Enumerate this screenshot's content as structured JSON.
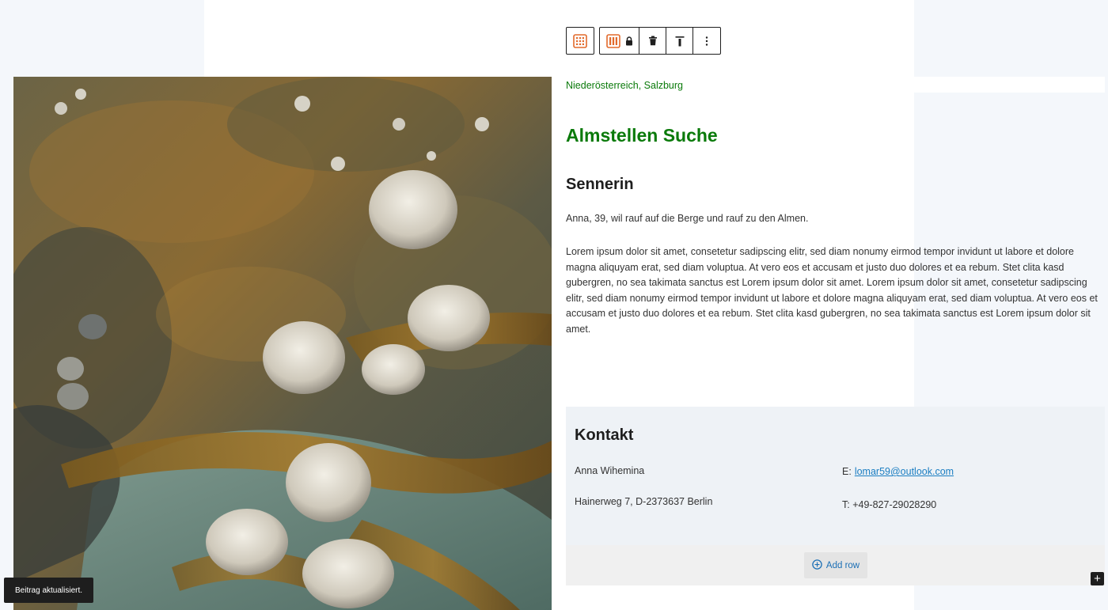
{
  "toolbar": {
    "buttons": [
      {
        "icon": "column-block-icon"
      },
      {
        "icon": "columns-lock-icon"
      },
      {
        "icon": "trash-icon"
      },
      {
        "icon": "align-top-icon"
      },
      {
        "icon": "more-options-icon"
      }
    ],
    "accent_color": "#e26a2c"
  },
  "image": {
    "subject": "seashells-on-rocks",
    "icon": "image"
  },
  "content": {
    "region": "Niederösterreich, Salzburg",
    "title": "Almstellen Suche",
    "subtitle": "Sennerin",
    "intro": "Anna, 39, wil rauf auf die Berge und rauf zu den Almen.",
    "body": "Lorem ipsum dolor sit amet, consetetur sadipscing elitr, sed diam nonumy eirmod tempor invidunt ut labore et dolore magna aliquyam erat, sed diam voluptua. At vero eos et accusam et justo duo dolores et ea rebum. Stet clita kasd gubergren, no sea takimata sanctus est Lorem ipsum dolor sit amet. Lorem ipsum dolor sit amet, consetetur sadipscing elitr, sed diam nonumy eirmod tempor invidunt ut labore et dolore magna aliquyam erat, sed diam voluptua. At vero eos et accusam et justo duo dolores et ea rebum. Stet clita kasd gubergren, no sea takimata sanctus est Lorem ipsum dolor sit amet.",
    "heading_color": "#0a7a0a"
  },
  "contact": {
    "title": "Kontakt",
    "name": "Anna Wihemina",
    "address": "Hainerweg 7, D-2373637 Berlin",
    "email_label": "E:",
    "email": "lomar59@outlook.com",
    "phone_label": "T:",
    "phone": "+49-827-29028290"
  },
  "add_row": {
    "label": "Add row"
  },
  "plus": {
    "label": "+"
  },
  "snackbar": {
    "text": "Beitrag aktualisiert."
  }
}
